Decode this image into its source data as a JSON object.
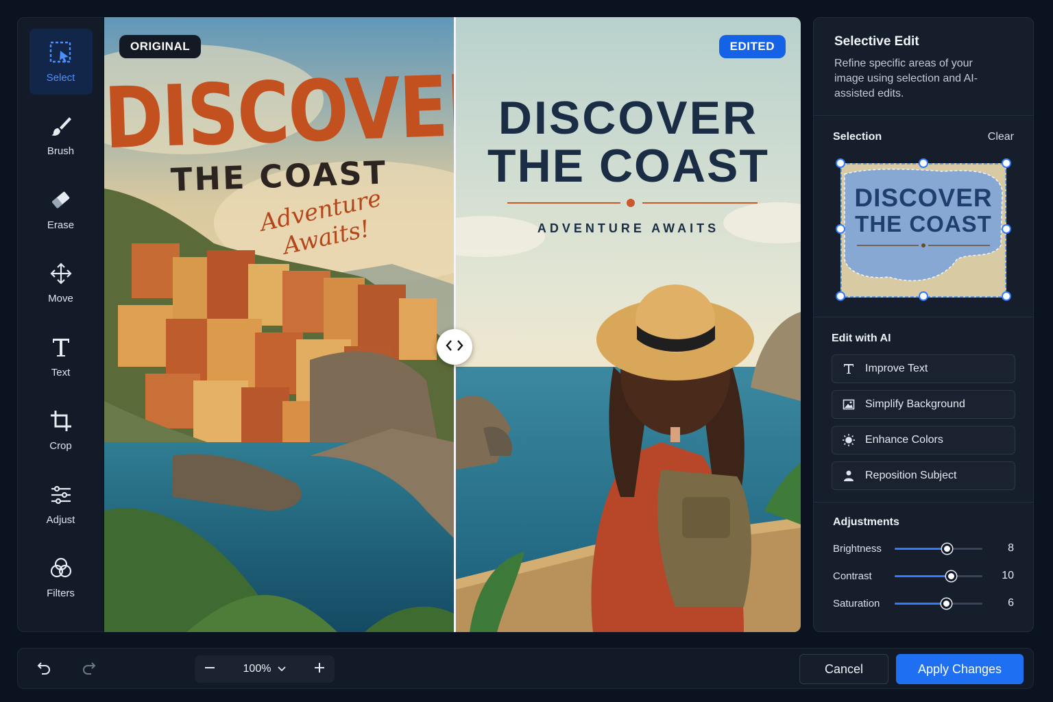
{
  "tools": [
    {
      "label": "Select",
      "icon": "selection-marquee-icon",
      "active": true
    },
    {
      "label": "Brush",
      "icon": "brush-icon"
    },
    {
      "label": "Erase",
      "icon": "eraser-icon"
    },
    {
      "label": "Move",
      "icon": "move-arrows-icon"
    },
    {
      "label": "Text",
      "icon": "text-t-icon"
    },
    {
      "label": "Crop",
      "icon": "crop-icon"
    },
    {
      "label": "Adjust",
      "icon": "sliders-icon"
    },
    {
      "label": "Filters",
      "icon": "filters-circles-icon"
    }
  ],
  "canvas": {
    "original_tag": "ORIGINAL",
    "edited_tag": "EDITED",
    "original_poster": {
      "headline": "DISCOVER",
      "subhead": "THE COAST",
      "tagline": "Adventure Awaits!"
    },
    "edited_poster": {
      "headline": "DISCOVER",
      "subhead": "THE COAST",
      "tagline": "ADVENTURE AWAITS"
    },
    "compare_position": 0.503
  },
  "panel": {
    "title": "Selective Edit",
    "description": "Refine specific areas of your image using selection and AI-assisted edits.",
    "selection": {
      "label": "Selection",
      "clear_label": "Clear",
      "preview_line1": "DISCOVER",
      "preview_line2": "THE COAST"
    },
    "ai": {
      "label": "Edit with AI",
      "actions": [
        {
          "label": "Improve Text",
          "icon": "text-t-icon"
        },
        {
          "label": "Simplify Background",
          "icon": "image-icon"
        },
        {
          "label": "Enhance Colors",
          "icon": "sun-icon"
        },
        {
          "label": "Reposition Subject",
          "icon": "person-icon"
        }
      ]
    },
    "adjustments": {
      "label": "Adjustments",
      "items": [
        {
          "label": "Brightness",
          "value": "8",
          "level": 0.6
        },
        {
          "label": "Contrast",
          "value": "10",
          "level": 0.65
        },
        {
          "label": "Saturation",
          "value": "6",
          "level": 0.59
        }
      ]
    }
  },
  "bottom": {
    "zoom": "100%",
    "cancel_label": "Cancel",
    "apply_label": "Apply Changes"
  },
  "colors": {
    "accent": "#1f6ff2",
    "background": "#0b1220",
    "panel": "#161e2b"
  }
}
